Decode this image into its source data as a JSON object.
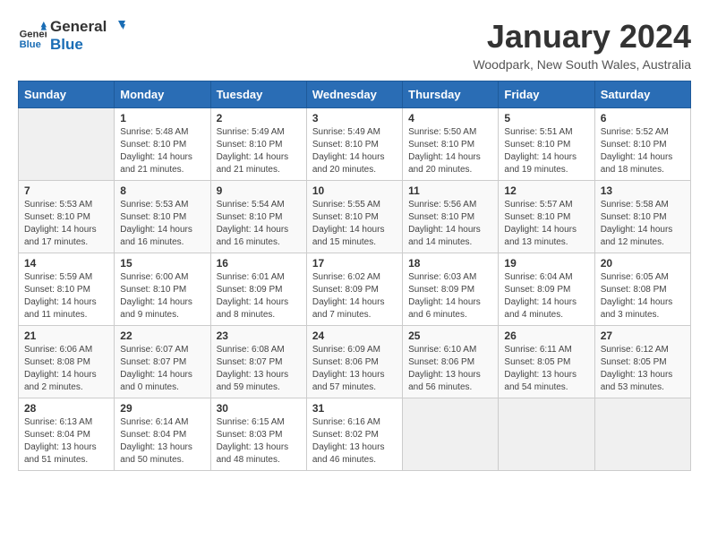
{
  "logo": {
    "text_general": "General",
    "text_blue": "Blue"
  },
  "title": "January 2024",
  "location": "Woodpark, New South Wales, Australia",
  "days_header": [
    "Sunday",
    "Monday",
    "Tuesday",
    "Wednesday",
    "Thursday",
    "Friday",
    "Saturday"
  ],
  "weeks": [
    [
      {
        "day": "",
        "info": ""
      },
      {
        "day": "1",
        "info": "Sunrise: 5:48 AM\nSunset: 8:10 PM\nDaylight: 14 hours\nand 21 minutes."
      },
      {
        "day": "2",
        "info": "Sunrise: 5:49 AM\nSunset: 8:10 PM\nDaylight: 14 hours\nand 21 minutes."
      },
      {
        "day": "3",
        "info": "Sunrise: 5:49 AM\nSunset: 8:10 PM\nDaylight: 14 hours\nand 20 minutes."
      },
      {
        "day": "4",
        "info": "Sunrise: 5:50 AM\nSunset: 8:10 PM\nDaylight: 14 hours\nand 20 minutes."
      },
      {
        "day": "5",
        "info": "Sunrise: 5:51 AM\nSunset: 8:10 PM\nDaylight: 14 hours\nand 19 minutes."
      },
      {
        "day": "6",
        "info": "Sunrise: 5:52 AM\nSunset: 8:10 PM\nDaylight: 14 hours\nand 18 minutes."
      }
    ],
    [
      {
        "day": "7",
        "info": "Sunrise: 5:53 AM\nSunset: 8:10 PM\nDaylight: 14 hours\nand 17 minutes."
      },
      {
        "day": "8",
        "info": "Sunrise: 5:53 AM\nSunset: 8:10 PM\nDaylight: 14 hours\nand 16 minutes."
      },
      {
        "day": "9",
        "info": "Sunrise: 5:54 AM\nSunset: 8:10 PM\nDaylight: 14 hours\nand 16 minutes."
      },
      {
        "day": "10",
        "info": "Sunrise: 5:55 AM\nSunset: 8:10 PM\nDaylight: 14 hours\nand 15 minutes."
      },
      {
        "day": "11",
        "info": "Sunrise: 5:56 AM\nSunset: 8:10 PM\nDaylight: 14 hours\nand 14 minutes."
      },
      {
        "day": "12",
        "info": "Sunrise: 5:57 AM\nSunset: 8:10 PM\nDaylight: 14 hours\nand 13 minutes."
      },
      {
        "day": "13",
        "info": "Sunrise: 5:58 AM\nSunset: 8:10 PM\nDaylight: 14 hours\nand 12 minutes."
      }
    ],
    [
      {
        "day": "14",
        "info": "Sunrise: 5:59 AM\nSunset: 8:10 PM\nDaylight: 14 hours\nand 11 minutes."
      },
      {
        "day": "15",
        "info": "Sunrise: 6:00 AM\nSunset: 8:10 PM\nDaylight: 14 hours\nand 9 minutes."
      },
      {
        "day": "16",
        "info": "Sunrise: 6:01 AM\nSunset: 8:09 PM\nDaylight: 14 hours\nand 8 minutes."
      },
      {
        "day": "17",
        "info": "Sunrise: 6:02 AM\nSunset: 8:09 PM\nDaylight: 14 hours\nand 7 minutes."
      },
      {
        "day": "18",
        "info": "Sunrise: 6:03 AM\nSunset: 8:09 PM\nDaylight: 14 hours\nand 6 minutes."
      },
      {
        "day": "19",
        "info": "Sunrise: 6:04 AM\nSunset: 8:09 PM\nDaylight: 14 hours\nand 4 minutes."
      },
      {
        "day": "20",
        "info": "Sunrise: 6:05 AM\nSunset: 8:08 PM\nDaylight: 14 hours\nand 3 minutes."
      }
    ],
    [
      {
        "day": "21",
        "info": "Sunrise: 6:06 AM\nSunset: 8:08 PM\nDaylight: 14 hours\nand 2 minutes."
      },
      {
        "day": "22",
        "info": "Sunrise: 6:07 AM\nSunset: 8:07 PM\nDaylight: 14 hours\nand 0 minutes."
      },
      {
        "day": "23",
        "info": "Sunrise: 6:08 AM\nSunset: 8:07 PM\nDaylight: 13 hours\nand 59 minutes."
      },
      {
        "day": "24",
        "info": "Sunrise: 6:09 AM\nSunset: 8:06 PM\nDaylight: 13 hours\nand 57 minutes."
      },
      {
        "day": "25",
        "info": "Sunrise: 6:10 AM\nSunset: 8:06 PM\nDaylight: 13 hours\nand 56 minutes."
      },
      {
        "day": "26",
        "info": "Sunrise: 6:11 AM\nSunset: 8:05 PM\nDaylight: 13 hours\nand 54 minutes."
      },
      {
        "day": "27",
        "info": "Sunrise: 6:12 AM\nSunset: 8:05 PM\nDaylight: 13 hours\nand 53 minutes."
      }
    ],
    [
      {
        "day": "28",
        "info": "Sunrise: 6:13 AM\nSunset: 8:04 PM\nDaylight: 13 hours\nand 51 minutes."
      },
      {
        "day": "29",
        "info": "Sunrise: 6:14 AM\nSunset: 8:04 PM\nDaylight: 13 hours\nand 50 minutes."
      },
      {
        "day": "30",
        "info": "Sunrise: 6:15 AM\nSunset: 8:03 PM\nDaylight: 13 hours\nand 48 minutes."
      },
      {
        "day": "31",
        "info": "Sunrise: 6:16 AM\nSunset: 8:02 PM\nDaylight: 13 hours\nand 46 minutes."
      },
      {
        "day": "",
        "info": ""
      },
      {
        "day": "",
        "info": ""
      },
      {
        "day": "",
        "info": ""
      }
    ]
  ]
}
